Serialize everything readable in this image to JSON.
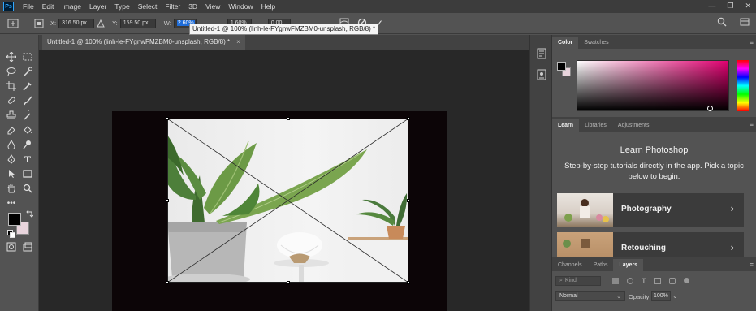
{
  "app": {
    "logo_text": "Ps"
  },
  "menu": [
    "File",
    "Edit",
    "Image",
    "Layer",
    "Type",
    "Select",
    "Filter",
    "3D",
    "View",
    "Window",
    "Help"
  ],
  "window_controls": [
    "—",
    "❐",
    "✕"
  ],
  "options": {
    "x_label": "X:",
    "x_value": "316.50 px",
    "y_label": "Y:",
    "y_value": "159.50 px",
    "w_label": "W:",
    "w_value": "2.60%",
    "h_value": "1.60%",
    "angle_value": "0.00",
    "commit_icon": "✓",
    "cancel_icon": "⃠"
  },
  "tooltip": "Untitled-1 @ 100% (linh-le-FYgnwFMZBM0-unsplash, RGB/8) *",
  "document_tab": {
    "title": "Untitled-1 @ 100% (linh-le-FYgnwFMZBM0-unsplash, RGB/8) *",
    "close": "×"
  },
  "colors": {
    "foreground": "#000000",
    "background": "#e8d4dc",
    "accent": "#1e6cd8"
  },
  "color_panel": {
    "tabs": [
      "Color",
      "Swatches"
    ]
  },
  "learn_panel": {
    "tabs": [
      "Learn",
      "Libraries",
      "Adjustments"
    ],
    "title": "Learn Photoshop",
    "description": "Step-by-step tutorials directly in the app. Pick a topic below to begin.",
    "cards": [
      {
        "label": "Photography",
        "chevron": "›"
      },
      {
        "label": "Retouching",
        "chevron": "›"
      }
    ]
  },
  "layers_panel": {
    "tabs": [
      "Channels",
      "Paths",
      "Layers"
    ],
    "kind_placeholder": "Kind",
    "blend_mode": "Normal",
    "opacity_label": "Opacity:",
    "opacity_value": "100%"
  }
}
